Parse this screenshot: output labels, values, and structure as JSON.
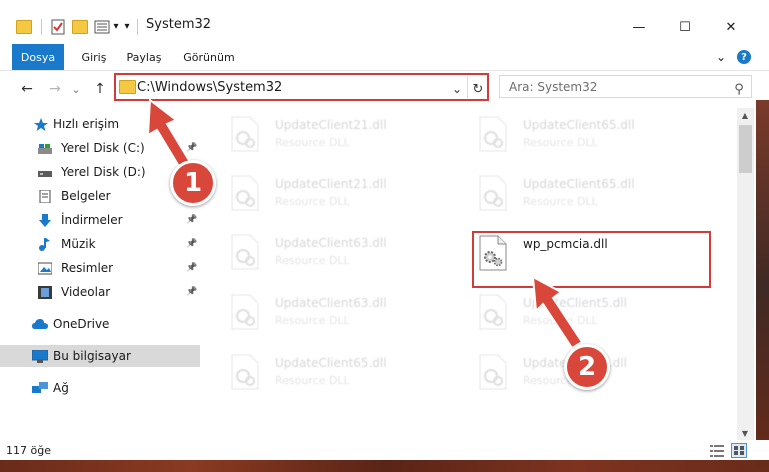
{
  "window": {
    "title": "System32",
    "minimize_glyph": "—",
    "maximize_glyph": "☐",
    "close_glyph": "✕"
  },
  "quick_access_toolbar": {
    "dropdown_glyph": "▾"
  },
  "ribbon": {
    "tabs": [
      {
        "label": "Dosya"
      },
      {
        "label": "Giriş"
      },
      {
        "label": "Paylaş"
      },
      {
        "label": "Görünüm"
      }
    ],
    "expand_glyph": "⌄",
    "help_glyph": "?"
  },
  "address_bar": {
    "back_glyph": "←",
    "forward_glyph": "→",
    "recent_glyph": "⌄",
    "up_glyph": "↑",
    "path": "C:\\Windows\\System32",
    "dropdown_glyph": "⌄",
    "refresh_glyph": "↻"
  },
  "search": {
    "placeholder": "Ara: System32",
    "icon_glyph": "⚲"
  },
  "sidebar": {
    "items": [
      {
        "label": "Hızlı erişim",
        "icon": "star-icon"
      },
      {
        "label": "Yerel Disk (C:)",
        "icon": "drive-icon",
        "pinned": true
      },
      {
        "label": "Yerel Disk (D:)",
        "icon": "drive-icon"
      },
      {
        "label": "Belgeler",
        "icon": "documents-icon"
      },
      {
        "label": "İndirmeler",
        "icon": "download-icon",
        "pinned": true
      },
      {
        "label": "Müzik",
        "icon": "music-icon",
        "pinned": true
      },
      {
        "label": "Resimler",
        "icon": "pictures-icon",
        "pinned": true
      },
      {
        "label": "Videolar",
        "icon": "videos-icon",
        "pinned": true
      },
      {
        "label": "OneDrive",
        "icon": "cloud-icon"
      },
      {
        "label": "Bu bilgisayar",
        "icon": "computer-icon",
        "selected": true
      },
      {
        "label": "Ağ",
        "icon": "network-icon"
      }
    ],
    "pin_glyph": "📌"
  },
  "files": [
    {
      "name": "UpdateClient21.dll",
      "type": "Resource DLL",
      "faded": true
    },
    {
      "name": "UpdateClient65.dll",
      "type": "Resource DLL",
      "faded": true
    },
    {
      "name": "UpdateClient21.dll",
      "type": "Resource DLL",
      "faded": true
    },
    {
      "name": "UpdateClient65.dll",
      "type": "Resource DLL",
      "faded": true
    },
    {
      "name": "UpdateClient63.dll",
      "type": "Resource DLL",
      "faded": true
    },
    {
      "name": "wp_pcmcia.dll",
      "type": "",
      "faded": false
    },
    {
      "name": "UpdateClient63.dll",
      "type": "Resource DLL",
      "faded": true
    },
    {
      "name": "UpdateClient5.dll",
      "type": "Resource DLL",
      "faded": true
    },
    {
      "name": "UpdateClient65.dll",
      "type": "Resource DLL",
      "faded": true
    },
    {
      "name": "UpdateClient5.dll",
      "type": "Resource DLL",
      "faded": true
    }
  ],
  "status_bar": {
    "item_count": "117 öğe"
  },
  "callouts": [
    {
      "number": "1"
    },
    {
      "number": "2"
    }
  ],
  "colors": {
    "accent": "#1979ca",
    "highlight_red": "#d33a3a",
    "callout_red": "#d9463a",
    "selected_bg": "#d9d9d9"
  }
}
